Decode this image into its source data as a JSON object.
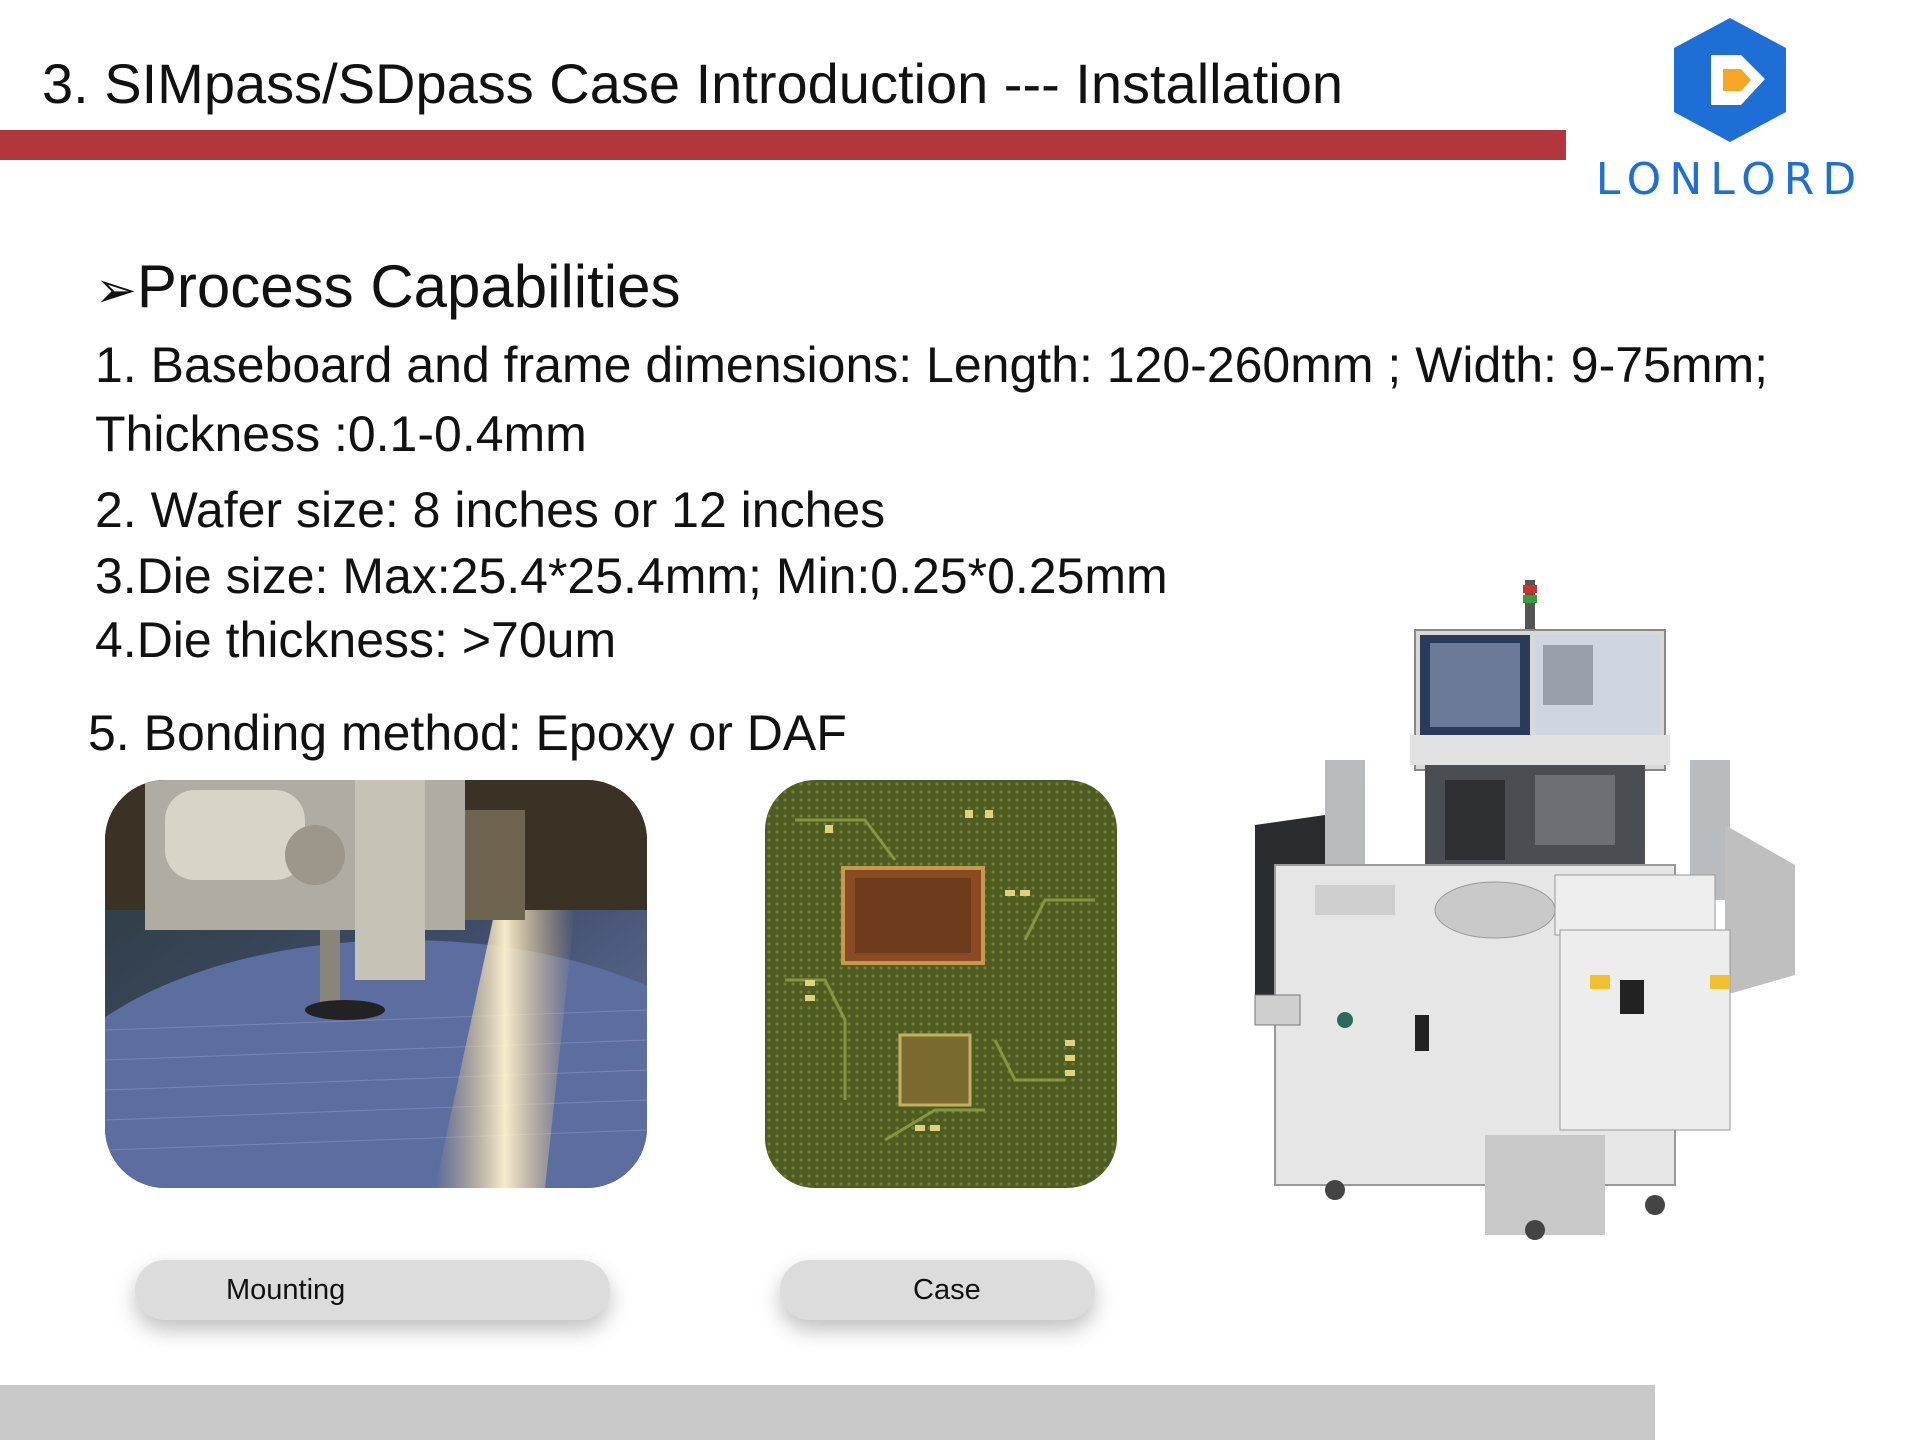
{
  "slide": {
    "title": "3. SIMpass/SDpass Case Introduction --- Installation",
    "logo_text": "LONLORD",
    "section_heading": {
      "bullet": "➢",
      "text": "Process Capabilities"
    },
    "capabilities": [
      {
        "line1": "1. Baseboard and frame dimensions: Length: 120-260mm ; Width: 9-75mm;",
        "line2": "Thickness :0.1-0.4mm"
      },
      {
        "line1": "2. Wafer size: 8 inches or 12 inches"
      },
      {
        "line1": "3.Die size: Max:25.4*25.4mm; Min:0.25*0.25mm"
      },
      {
        "line1": "4.Die thickness: >70um"
      },
      {
        "line1": "5. Bonding method: Epoxy or DAF"
      }
    ],
    "images": [
      {
        "caption": "Mounting",
        "icon": "wafer-mounting-photo"
      },
      {
        "caption": "Case",
        "icon": "circuit-board-photo"
      },
      {
        "icon": "die-bonder-machine-photo"
      }
    ],
    "colors": {
      "accent_red": "#b3363c",
      "logo_blue": "#1d6fd6",
      "logo_orange": "#f5a623",
      "footer_gray": "#c8c8c8"
    }
  }
}
